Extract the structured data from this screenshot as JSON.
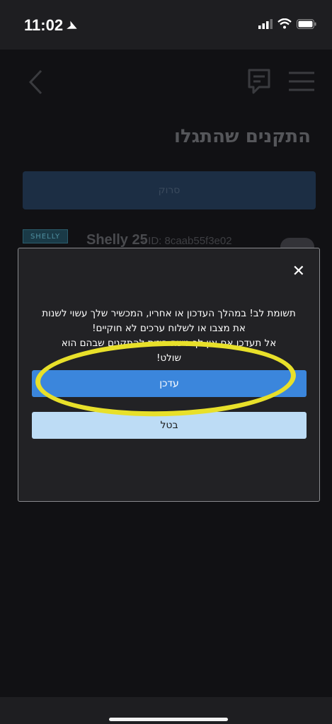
{
  "status_bar": {
    "time": "11:02",
    "icons": [
      "location-arrow-icon",
      "signal-icon",
      "wifi-icon",
      "battery-icon"
    ]
  },
  "header": {
    "icons": [
      "back-chevron-icon",
      "chat-icon",
      "hamburger-menu-icon"
    ]
  },
  "page": {
    "title": "התקנים שהתגלו",
    "search_button_label": "סרוק"
  },
  "device": {
    "badge": "SHELLY",
    "name": "Shelly 25",
    "id_text": "- ID: 8caab55f3e02"
  },
  "modal": {
    "close_icon": "close-icon",
    "message_lines": [
      "תשומת לב! במהלך העדכון או אחריו, המכשיר שלך עשוי לשנות",
      "את מצבו או לשלוח ערכים לא חוקיים!",
      "אל תעדכן אם אין לך גישה פיזית להתקנים שבהם הוא",
      "שולט!"
    ],
    "update_button_label": "עדכן",
    "cancel_button_label": "בטל"
  },
  "colors": {
    "accent_blue": "#3b86dc",
    "cancel_light_blue": "#bddcf5",
    "highlight_yellow": "#e8e02a",
    "modal_background": "#222225"
  }
}
